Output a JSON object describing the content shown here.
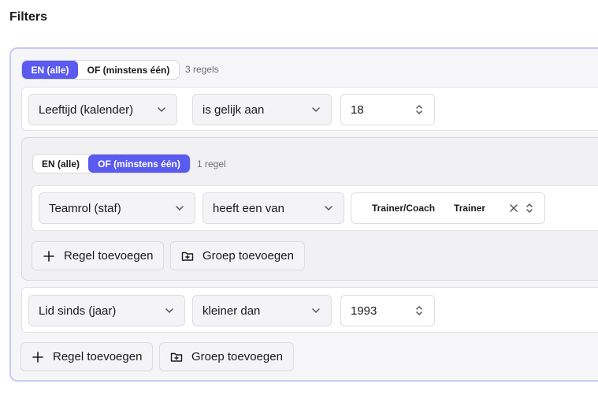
{
  "title": "Filters",
  "root": {
    "logic": {
      "and_label": "EN (alle)",
      "or_label": "OF (minstens één)",
      "active": "and"
    },
    "count": "3 regels",
    "rule1": {
      "field": "Leeftijd (kalender)",
      "operator": "is gelijk aan",
      "value": "18"
    },
    "rule2": {
      "field": "Lid sinds (jaar)",
      "operator": "kleiner dan",
      "value": "1993"
    },
    "add_rule": "Regel toevoegen",
    "add_group": "Groep toevoegen"
  },
  "group": {
    "logic": {
      "and_label": "EN (alle)",
      "or_label": "OF (minstens één)",
      "active": "or"
    },
    "count": "1 regel",
    "rule": {
      "field": "Teamrol (staf)",
      "operator": "heeft een van",
      "values": [
        "Trainer/Coach",
        "Trainer"
      ]
    },
    "add_rule": "Regel toevoegen",
    "add_group": "Groep toevoegen"
  },
  "colors": {
    "accent": "#5b5bf0",
    "border_accent": "#c7c9f5"
  },
  "icons": {
    "chevron": "chevron-down-icon",
    "stepper": "up-down-chevron-icon",
    "clear": "close-icon",
    "add": "plus-icon",
    "folder": "folder-plus-icon"
  }
}
